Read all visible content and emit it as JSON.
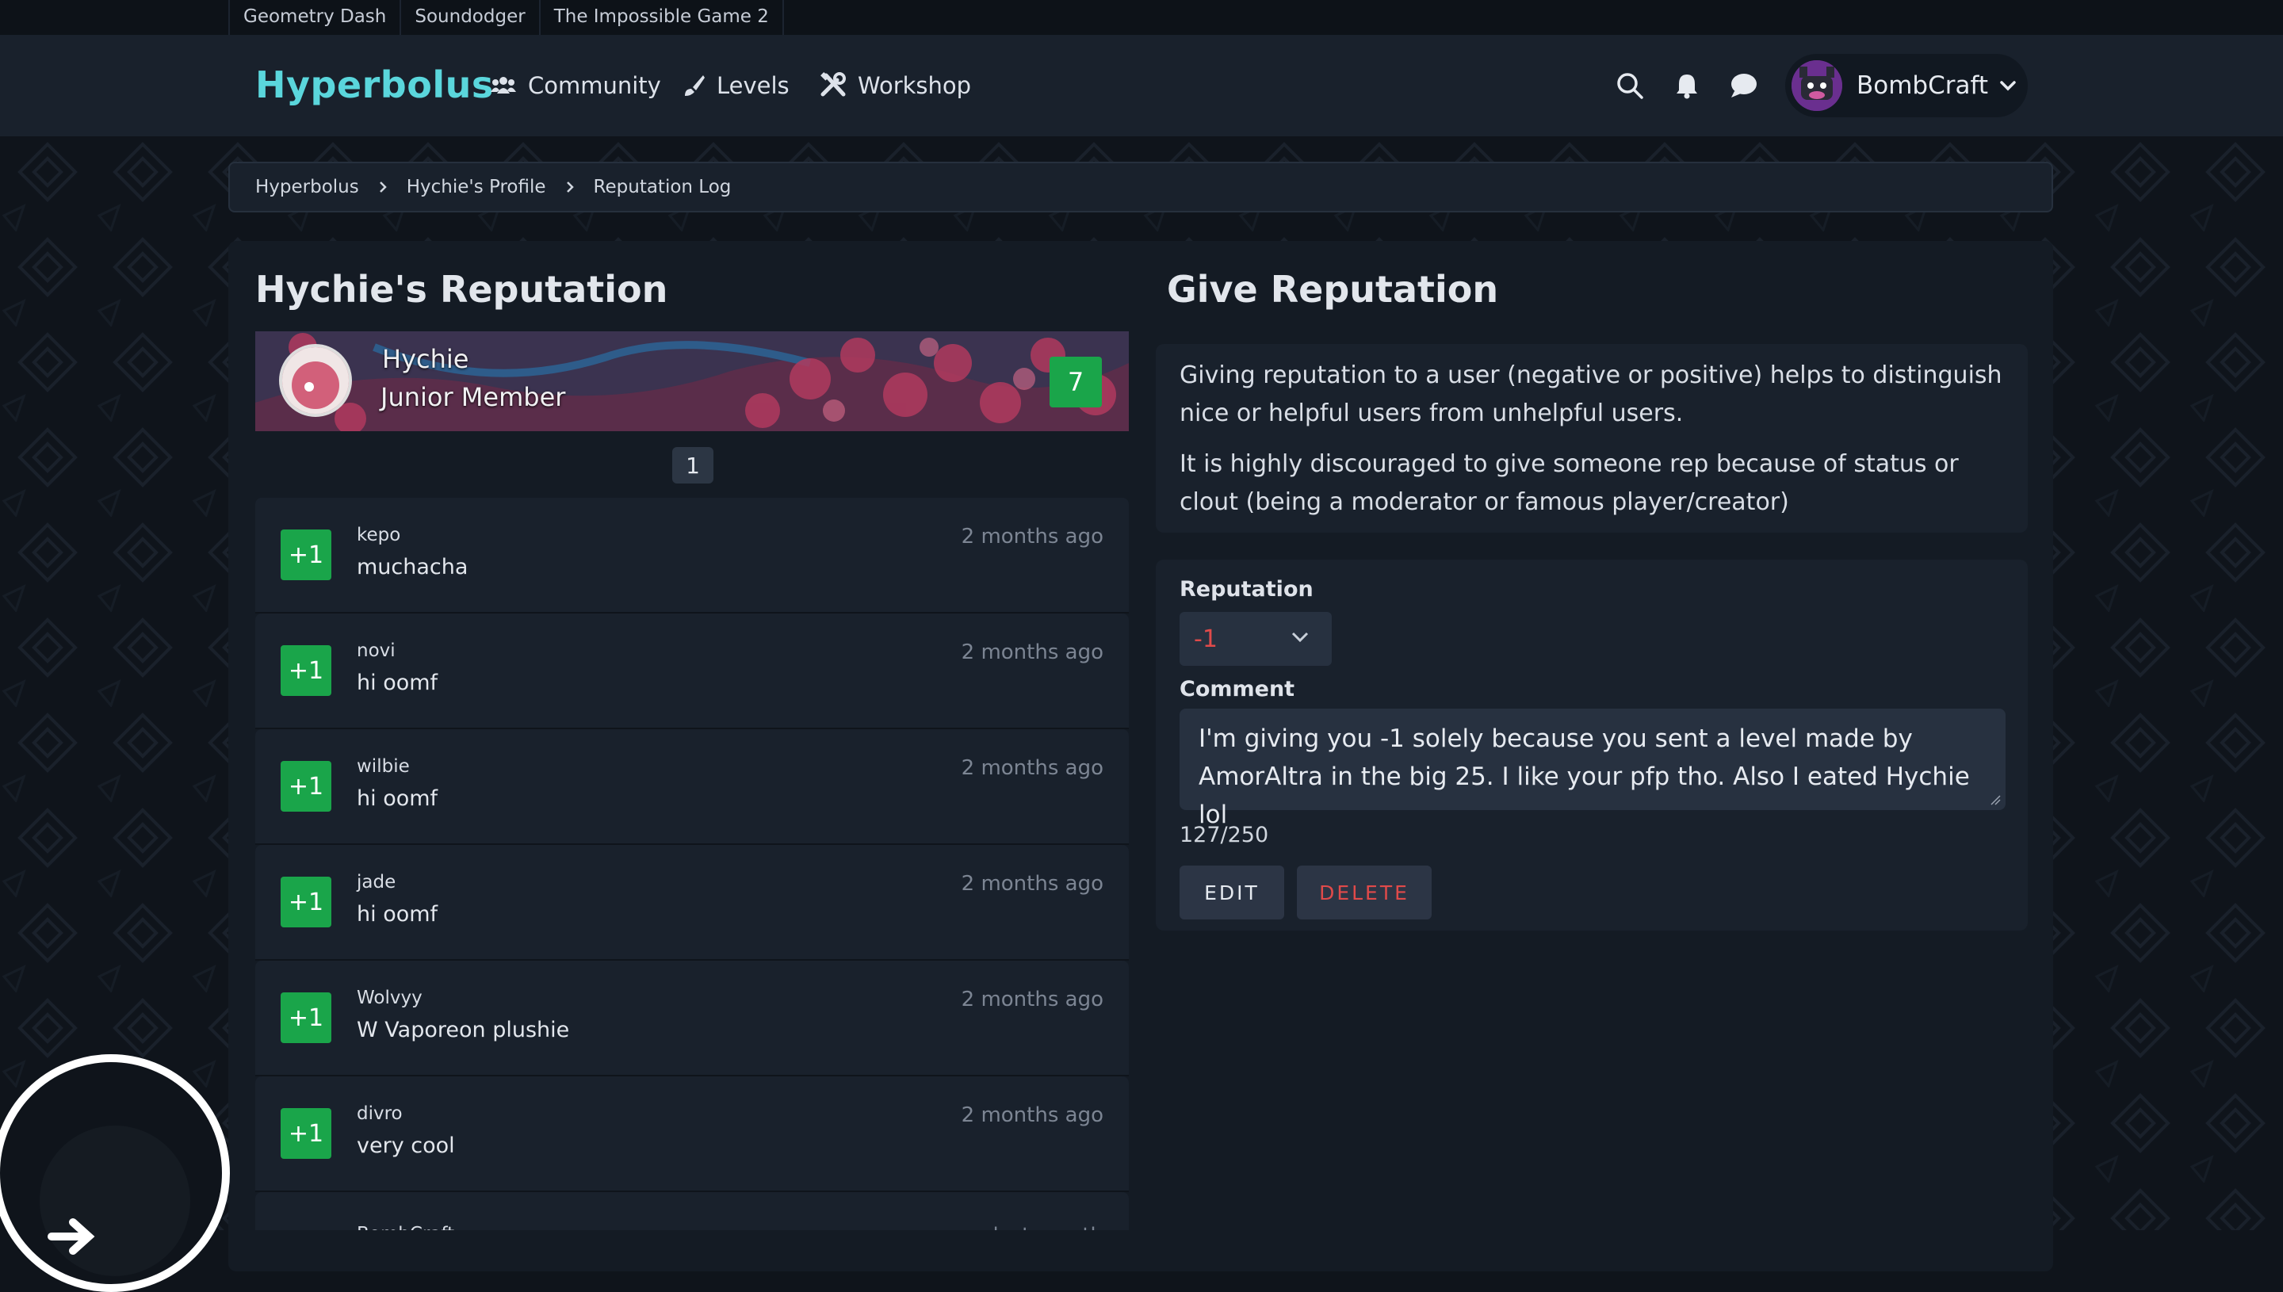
{
  "top_links": [
    "Geometry Dash",
    "Soundodger",
    "The Impossible Game 2"
  ],
  "nav": {
    "brand": "Hyperbolus",
    "items": [
      {
        "label": "Community",
        "icon": "users-icon"
      },
      {
        "label": "Levels",
        "icon": "brush-icon"
      },
      {
        "label": "Workshop",
        "icon": "tools-icon"
      }
    ],
    "username": "BombCraft"
  },
  "breadcrumb": [
    "Hyperbolus",
    "Hychie's Profile",
    "Reputation Log"
  ],
  "left": {
    "title": "Hychie's Reputation",
    "profile": {
      "name": "Hychie",
      "role": "Junior Member",
      "score": "7"
    },
    "page": "1",
    "entries": [
      {
        "value": "+1",
        "user": "kepo",
        "comment": "muchacha",
        "time": "2 months ago"
      },
      {
        "value": "+1",
        "user": "novi",
        "comment": "hi oomf",
        "time": "2 months ago"
      },
      {
        "value": "+1",
        "user": "wilbie",
        "comment": "hi oomf",
        "time": "2 months ago"
      },
      {
        "value": "+1",
        "user": "jade",
        "comment": "hi oomf",
        "time": "2 months ago"
      },
      {
        "value": "+1",
        "user": "Wolvyy",
        "comment": "W Vaporeon plushie",
        "time": "2 months ago"
      },
      {
        "value": "+1",
        "user": "divro",
        "comment": "very cool",
        "time": "2 months ago"
      },
      {
        "value": "",
        "user": "BombCraft",
        "comment": "",
        "time": "last month"
      }
    ]
  },
  "right": {
    "title": "Give Reputation",
    "info_p1": "Giving reputation to a user (negative or positive) helps to distinguish nice or helpful users from unhelpful users.",
    "info_p2": "It is highly discouraged to give someone rep because of status or clout (being a moderator or famous player/creator)",
    "reputation_label": "Reputation",
    "reputation_value": "-1",
    "comment_label": "Comment",
    "comment_value": "I'm giving you -1 solely because you sent a level made by AmorAltra in the big 25. I like your pfp tho. Also I eated Hychie lol",
    "counter": "127/250",
    "edit_label": "EDIT",
    "delete_label": "DELETE"
  },
  "colors": {
    "brand": "#5ad6dc",
    "positive": "#1aa54a",
    "negative": "#e04a4a"
  }
}
